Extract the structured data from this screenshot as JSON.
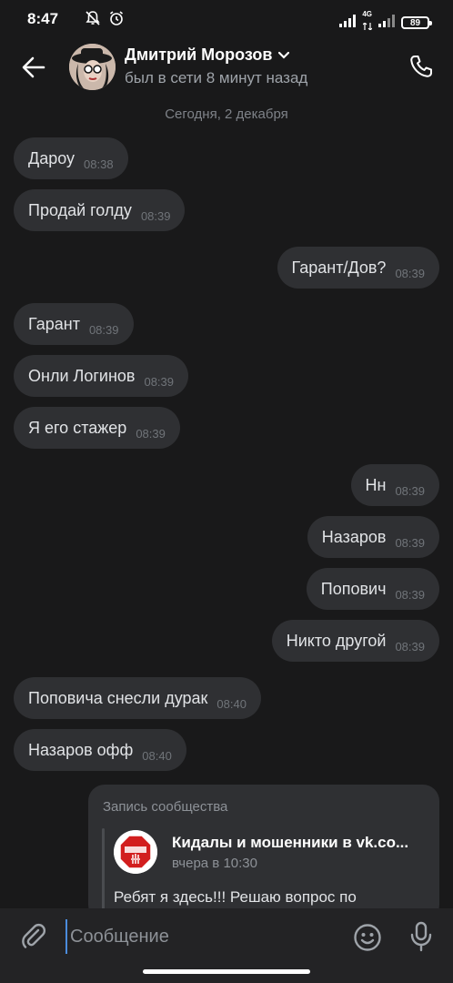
{
  "status_bar": {
    "time": "8:47",
    "network": "4G",
    "battery": "89"
  },
  "header": {
    "contact_name": "Дмитрий Морозов",
    "contact_status": "был в сети 8 минут назад"
  },
  "date_separator": "Сегодня, 2 декабря",
  "messages": [
    {
      "dir": "in",
      "text": "Дароу",
      "time": "08:38"
    },
    {
      "dir": "in",
      "text": "Продай голду",
      "time": "08:39"
    },
    {
      "dir": "out",
      "text": "Гарант/Дов?",
      "time": "08:39"
    },
    {
      "dir": "in",
      "text": "Гарант",
      "time": "08:39"
    },
    {
      "dir": "in",
      "text": "Онли Логинов",
      "time": "08:39"
    },
    {
      "dir": "in",
      "text": "Я его стажер",
      "time": "08:39"
    },
    {
      "dir": "out",
      "text": "Нн",
      "time": "08:39"
    },
    {
      "dir": "out",
      "text": "Назаров",
      "time": "08:39"
    },
    {
      "dir": "out",
      "text": "Попович",
      "time": "08:39"
    },
    {
      "dir": "out",
      "text": "Никто другой",
      "time": "08:39"
    },
    {
      "dir": "in",
      "text": "Поповича снесли дурак",
      "time": "08:40"
    },
    {
      "dir": "in",
      "text": "Назаров офф",
      "time": "08:40"
    }
  ],
  "repost": {
    "label": "Запись сообщества",
    "community": "Кидалы и мошенники в vk.co...",
    "date": "вчера в 10:30",
    "text": "Ребят я здесь!!! Решаю вопрос по"
  },
  "composer": {
    "placeholder": "Сообщение"
  }
}
